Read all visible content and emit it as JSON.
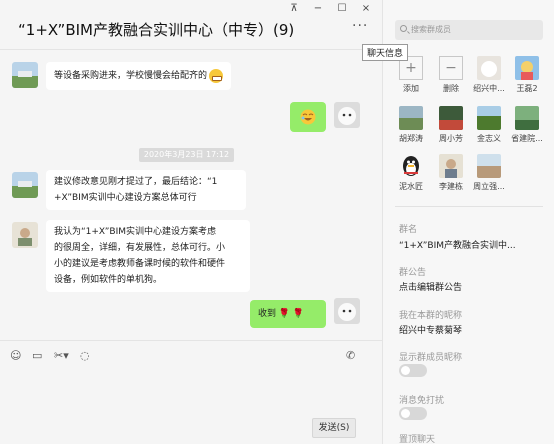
{
  "header": {
    "title": "“1+X”BIM产教融合实训中心（中专）(9)",
    "more_label": "···",
    "pin_label": "⊼",
    "minimize_label": "−",
    "maximize_label": "☐",
    "close_label": "×",
    "tooltip": "聊天信息"
  },
  "messages": [
    {
      "from": "other",
      "text": "等设备采购进来，学校慢慢会给配齐的"
    },
    {
      "from": "me",
      "emoji": "sticker"
    },
    {
      "type": "timestamp",
      "text": "2020年3月23日 17:12"
    },
    {
      "from": "other",
      "lines": [
        "建议修改意见刚才提过了，最后结论：“1",
        "+X”BIM实训中心建设方案总体可行"
      ]
    },
    {
      "from": "other",
      "lines": [
        "我认为“1+X”BIM实训中心建设方案考虑",
        "的很周全，详细，有发展性，总体可行。小",
        "小的建议是考虑教师备课时候的软件和硬件",
        "设备，例如软件的单机狗。"
      ]
    },
    {
      "from": "me",
      "text": "收到 🌹 🌹"
    }
  ],
  "toolbar": {
    "send_label": "发送(S)"
  },
  "side": {
    "search_placeholder": "搜索群成员",
    "members": [
      {
        "name": "添加",
        "kind": "add"
      },
      {
        "name": "删除",
        "kind": "remove"
      },
      {
        "name": "绍兴中...",
        "color": "#e8e4de"
      },
      {
        "name": "王磊2",
        "color": "#6fa7d8"
      },
      {
        "name": "胡郑涛",
        "color": "#7a9a6a"
      },
      {
        "name": "周小芳",
        "color": "#3d5a3a"
      },
      {
        "name": "金志义",
        "color": "#4d7a2e"
      },
      {
        "name": "省建院...",
        "color": "#5a8e5a"
      },
      {
        "name": "泥水匠",
        "color": "#222222"
      },
      {
        "name": "李建栋",
        "color": "#c9c2b0"
      },
      {
        "name": "周立强...",
        "color": "#b89a7a"
      }
    ],
    "group_name_label": "群名",
    "group_name_value": "“1+X”BIM产教融合实训中...",
    "announcement_label": "群公告",
    "announcement_value": "点击编辑群公告",
    "nickname_label": "我在本群的昵称",
    "nickname_value": "绍兴中专蔡菊琴",
    "show_nick_label": "显示群成员昵称",
    "dnd_label": "消息免打扰",
    "pin_label": "置顶聊天"
  }
}
